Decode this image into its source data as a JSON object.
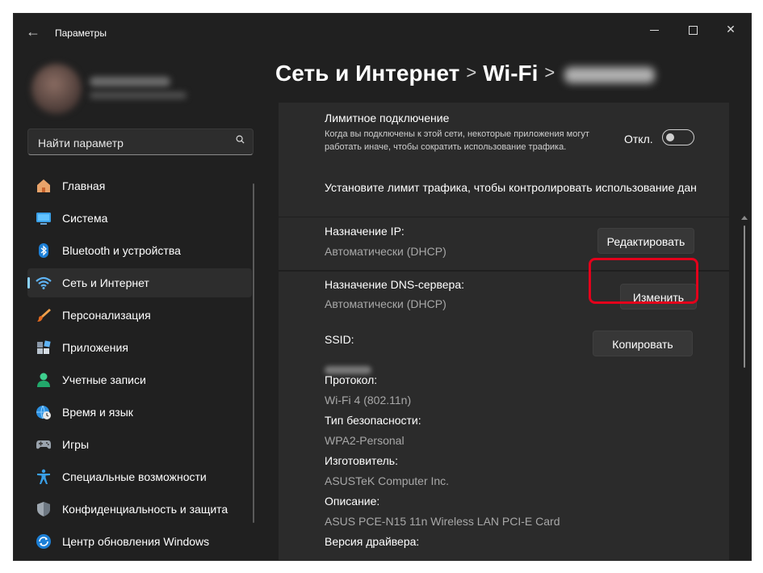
{
  "window": {
    "title": "Параметры"
  },
  "search": {
    "placeholder": "Найти параметр"
  },
  "sidebar": {
    "items": [
      {
        "label": "Главная",
        "icon": "home-icon"
      },
      {
        "label": "Система",
        "icon": "monitor-icon"
      },
      {
        "label": "Bluetooth и устройства",
        "icon": "bluetooth-icon"
      },
      {
        "label": "Сеть и Интернет",
        "icon": "wifi-icon",
        "selected": true
      },
      {
        "label": "Персонализация",
        "icon": "brush-icon"
      },
      {
        "label": "Приложения",
        "icon": "apps-icon"
      },
      {
        "label": "Учетные записи",
        "icon": "person-icon"
      },
      {
        "label": "Время и язык",
        "icon": "globe-clock-icon"
      },
      {
        "label": "Игры",
        "icon": "gamepad-icon"
      },
      {
        "label": "Специальные возможности",
        "icon": "accessibility-icon"
      },
      {
        "label": "Конфиденциальность и защита",
        "icon": "shield-icon"
      },
      {
        "label": "Центр обновления Windows",
        "icon": "update-icon"
      }
    ]
  },
  "breadcrumb": {
    "level1": "Сеть и Интернет",
    "separator": ">",
    "level2": "Wi-Fi"
  },
  "metered": {
    "title": "Лимитное подключение",
    "description": "Когда вы подключены к этой сети, некоторые приложения могут работать иначе, чтобы сократить использование трафика.",
    "toggle_label": "Откл.",
    "toggle_on": false,
    "data_limit_text": "Установите лимит трафика, чтобы контролировать использование дан"
  },
  "ip": {
    "label": "Назначение IP:",
    "value": "Автоматически (DHCP)",
    "button": "Редактировать"
  },
  "dns": {
    "label": "Назначение DNS-сервера:",
    "value": "Автоматически (DHCP)",
    "button": "Изменить"
  },
  "properties": {
    "copy_button": "Копировать",
    "ssid_label": "SSID:",
    "protocol_label": "Протокол:",
    "protocol_value": "Wi-Fi 4 (802.11n)",
    "security_label": "Тип безопасности:",
    "security_value": "WPA2-Personal",
    "manufacturer_label": "Изготовитель:",
    "manufacturer_value": "ASUSTeK Computer Inc.",
    "description_label": "Описание:",
    "description_value": "ASUS PCE-N15 11n Wireless LAN PCI-E Card",
    "driver_label": "Версия драйвера:"
  },
  "colors": {
    "background": "#202020",
    "card": "#2b2b2b",
    "accent": "#8ad2ff",
    "highlight": "#e3001b"
  }
}
